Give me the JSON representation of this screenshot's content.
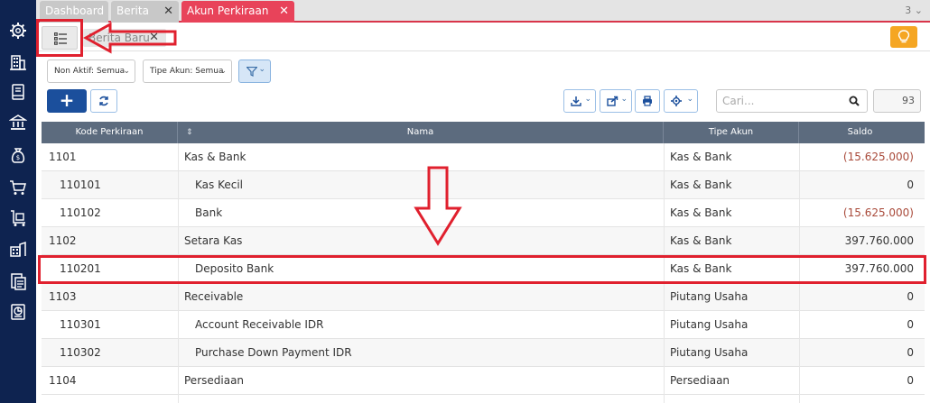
{
  "tabs": [
    {
      "label": "Dashboard",
      "active": false,
      "closable": false
    },
    {
      "label": "Berita",
      "active": false,
      "closable": true
    },
    {
      "label": "Akun Perkiraan",
      "active": true,
      "closable": true
    }
  ],
  "tab_count": "3",
  "subbar": {
    "subtab_label": "Berita Baru"
  },
  "filters": {
    "non_aktif": "Non Aktif: Semua",
    "tipe_akun": "Tipe Akun: Semua"
  },
  "search": {
    "placeholder": "Cari...",
    "count": "93"
  },
  "table": {
    "headers": {
      "code": "Kode Perkiraan",
      "name": "Nama",
      "type": "Tipe Akun",
      "saldo": "Saldo"
    },
    "rows": [
      {
        "code": "1101",
        "name": "Kas & Bank",
        "type": "Kas & Bank",
        "saldo": "(15.625.000)",
        "child": false,
        "negative": true
      },
      {
        "code": "110101",
        "name": "Kas Kecil",
        "type": "Kas & Bank",
        "saldo": "0",
        "child": true,
        "negative": false
      },
      {
        "code": "110102",
        "name": "Bank",
        "type": "Kas & Bank",
        "saldo": "(15.625.000)",
        "child": true,
        "negative": true
      },
      {
        "code": "1102",
        "name": "Setara Kas",
        "type": "Kas & Bank",
        "saldo": "397.760.000",
        "child": false,
        "negative": false
      },
      {
        "code": "110201",
        "name": "Deposito Bank",
        "type": "Kas & Bank",
        "saldo": "397.760.000",
        "child": true,
        "negative": false
      },
      {
        "code": "1103",
        "name": "Receivable",
        "type": "Piutang Usaha",
        "saldo": "0",
        "child": false,
        "negative": false
      },
      {
        "code": "110301",
        "name": "Account Receivable IDR",
        "type": "Piutang Usaha",
        "saldo": "0",
        "child": true,
        "negative": false
      },
      {
        "code": "110302",
        "name": "Purchase Down Payment IDR",
        "type": "Piutang Usaha",
        "saldo": "0",
        "child": true,
        "negative": false
      },
      {
        "code": "1104",
        "name": "Persediaan",
        "type": "Persediaan",
        "saldo": "0",
        "child": false,
        "negative": false
      }
    ]
  },
  "colors": {
    "nav_bg": "#0e2350",
    "active_tab": "#e8435a",
    "primary": "#1b4f9c",
    "header_bg": "#5c6b7e",
    "negative": "#a94a3a",
    "annotation": "#e0202e",
    "bulb": "#f5a623"
  },
  "nav_icons": [
    "settings-icon",
    "building-icon",
    "book-icon",
    "bank-icon",
    "money-bag-icon",
    "cart-icon",
    "trolley-icon",
    "warehouse-icon",
    "document-icon",
    "report-icon"
  ]
}
